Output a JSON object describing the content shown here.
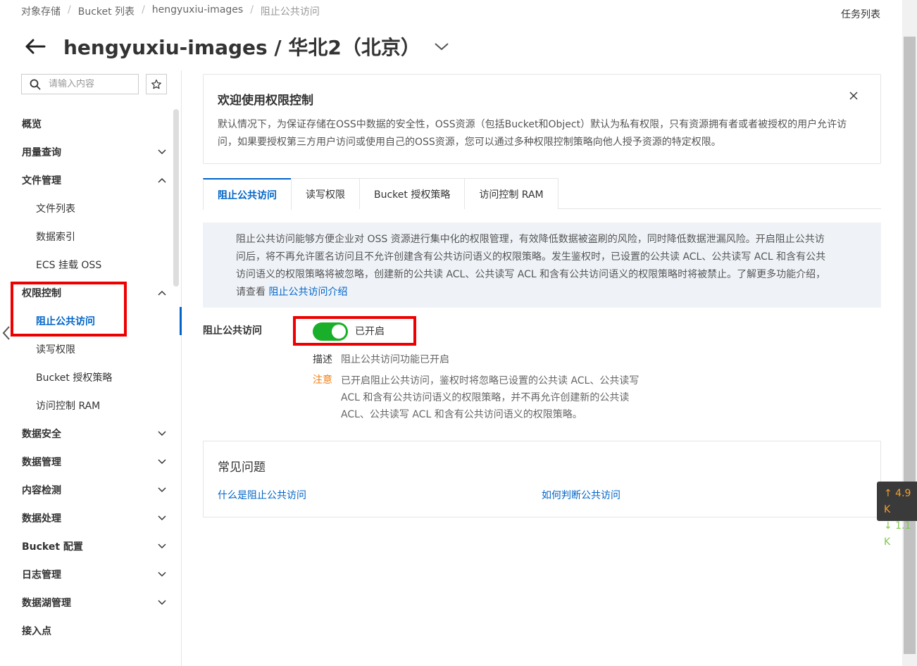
{
  "breadcrumb": [
    "对象存储",
    "Bucket 列表",
    "hengyuxiu-images",
    "阻止公共访问"
  ],
  "header": {
    "task_list": "任务列表",
    "title": "hengyuxiu-images / 华北2（北京）"
  },
  "sidebar": {
    "search_placeholder": "请输入内容",
    "items": [
      {
        "label": "概览"
      },
      {
        "label": "用量查询"
      },
      {
        "label": "文件管理"
      },
      {
        "label": "文件列表"
      },
      {
        "label": "数据索引"
      },
      {
        "label": "ECS 挂载 OSS"
      },
      {
        "label": "权限控制"
      },
      {
        "label": "阻止公共访问"
      },
      {
        "label": "读写权限"
      },
      {
        "label": "Bucket 授权策略"
      },
      {
        "label": "访问控制 RAM"
      },
      {
        "label": "数据安全"
      },
      {
        "label": "数据管理"
      },
      {
        "label": "内容检测"
      },
      {
        "label": "数据处理"
      },
      {
        "label": "Bucket 配置"
      },
      {
        "label": "日志管理"
      },
      {
        "label": "数据湖管理"
      },
      {
        "label": "接入点"
      }
    ]
  },
  "welcome": {
    "title": "欢迎使用权限控制",
    "text": "默认情况下，为保证存储在OSS中数据的安全性，OSS资源（包括Bucket和Object）默认为私有权限，只有资源拥有者或者被授权的用户允许访问，如果要授权第三方用户访问或使用自己的OSS资源，您可以通过多种权限控制策略向他人授予资源的特定权限。"
  },
  "tabs": [
    "阻止公共访问",
    "读写权限",
    "Bucket 授权策略",
    "访问控制 RAM"
  ],
  "info": {
    "line1": "阻止公共访问能够方便企业对 OSS 资源进行集中化的权限管理，有效降低数据被盗刷的风险，同时降低数据泄漏风险。开启阻止公共访",
    "line2": "问后，将不再允许匿名访问且不允许创建含有公共访问语义的权限策略。发生鉴权时，已设置的公共读 ACL、公共读写 ACL 和含有公共",
    "line3": "访问语义的权限策略将被忽略，创建新的公共读 ACL、公共读写 ACL 和含有公共访问语义的权限策略时将被禁止。了解更多功能介绍，",
    "line4_prefix": "请查看 ",
    "link": "阻止公共访问介绍"
  },
  "block_public": {
    "label": "阻止公共访问",
    "state": "已开启",
    "enabled": true,
    "desc_label": "描述",
    "desc_value": "阻止公共访问功能已开启",
    "note_label": "注意",
    "note_value": "已开启阻止公共访问，鉴权时将忽略已设置的公共读 ACL、公共读写 ACL 和含有公共访问语义的权限策略，并不再允许创建新的公共读 ACL、公共读写 ACL 和含有公共访问语义的权限策略。"
  },
  "faq": {
    "title": "常见问题",
    "q1": "什么是阻止公共访问",
    "q2": "如何判断公共访问"
  },
  "speed": {
    "up": "↑ 4.9 K",
    "down": "↓ 1.1 K"
  },
  "colors": {
    "accent": "#0064c8",
    "toggle_on": "#1aaf2b",
    "highlight_box": "#e00000",
    "warning": "#f47d0e"
  }
}
